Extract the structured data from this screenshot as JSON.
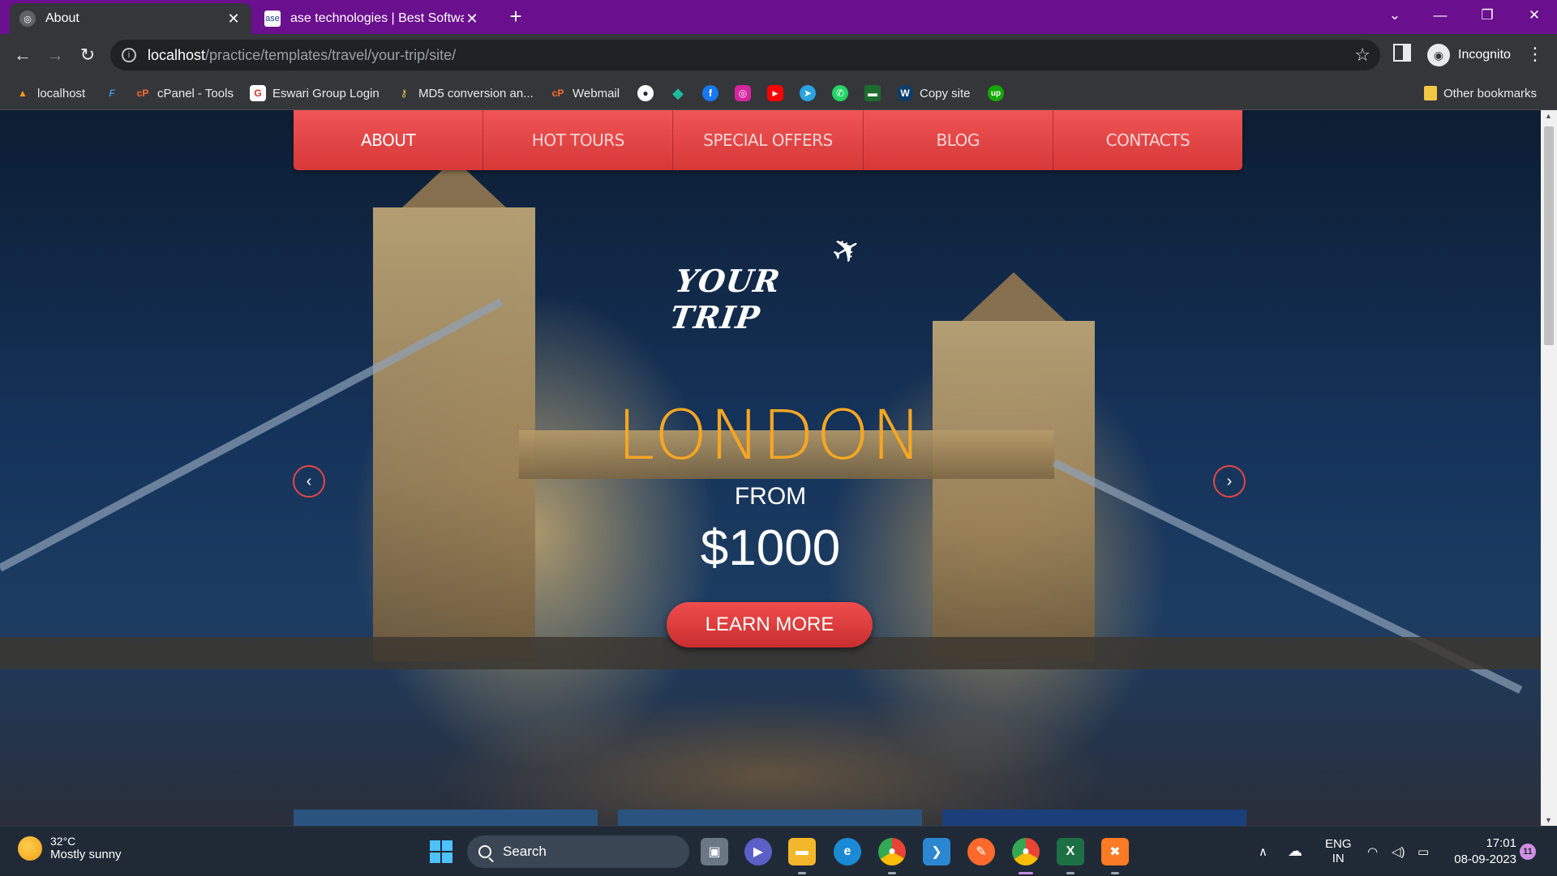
{
  "browser": {
    "tabs": [
      {
        "title": "About",
        "active": true
      },
      {
        "title": "ase technologies | Best Software",
        "active": false
      }
    ],
    "url_host": "localhost",
    "url_path": "/practice/templates/travel/your-trip/site/",
    "profile_label": "Incognito",
    "bookmarks": [
      {
        "label": "localhost",
        "icon": "xampp-icon"
      },
      {
        "label": "",
        "icon": "f-icon"
      },
      {
        "label": "cPanel - Tools",
        "icon": "cpanel-icon"
      },
      {
        "label": "Eswari Group Login",
        "icon": "g-icon"
      },
      {
        "label": "MD5 conversion an...",
        "icon": "key-icon"
      },
      {
        "label": "Webmail",
        "icon": "cpanel-icon"
      },
      {
        "label": "Copy site",
        "icon": "w-icon"
      }
    ],
    "other_bookmarks": "Other bookmarks"
  },
  "site": {
    "nav": [
      "ABOUT",
      "HOT TOURS",
      "SPECIAL OFFERS",
      "BLOG",
      "CONTACTS"
    ],
    "logo_text": "YOUR TRIP",
    "hero_city": "LONDON",
    "hero_from": "FROM",
    "hero_price": "$1000",
    "hero_button": "LEARN MORE",
    "prev_glyph": "‹",
    "next_glyph": "›",
    "colors": {
      "nav": "#e04444",
      "accent": "#f5a623"
    }
  },
  "taskbar": {
    "weather_temp": "32°C",
    "weather_desc": "Mostly sunny",
    "search_placeholder": "Search",
    "lang_top": "ENG",
    "lang_bottom": "IN",
    "time": "17:01",
    "date": "08-09-2023",
    "notification_count": "11"
  }
}
